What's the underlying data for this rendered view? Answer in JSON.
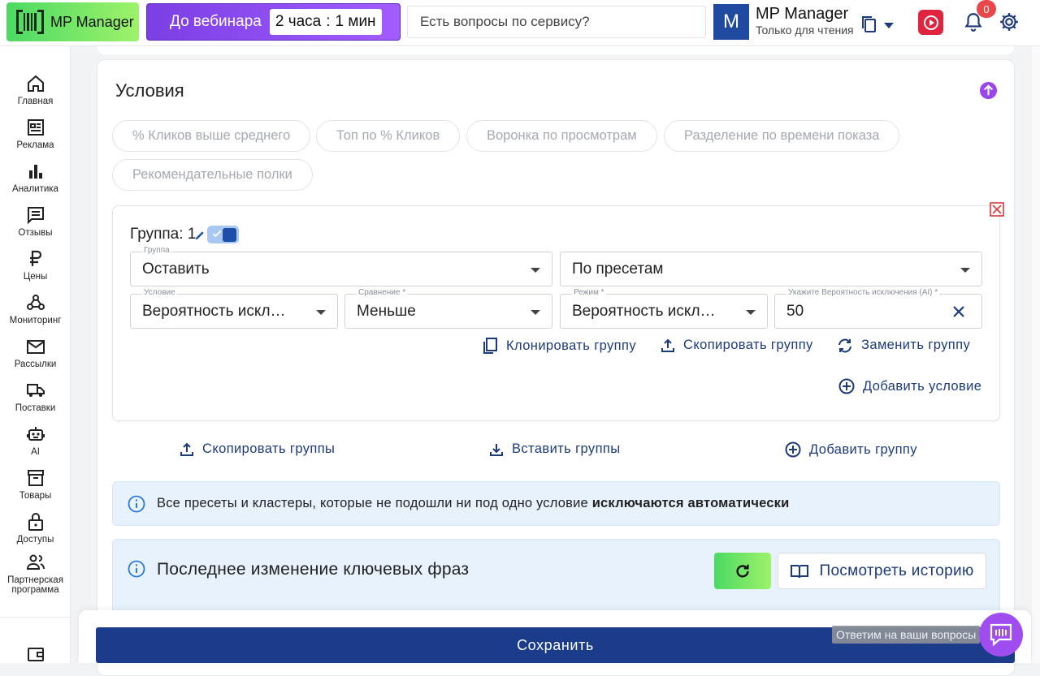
{
  "header": {
    "logo_text": "MP Manager",
    "webinar_label": "До вебинара",
    "timer_hours": "2 часа",
    "timer_sep": ":",
    "timer_minutes": "1 мин",
    "search_placeholder": "Есть вопросы по сервису?",
    "avatar_letter": "M",
    "user_name": "MP Manager",
    "user_role": "Только для чтения",
    "notifications_count": "0"
  },
  "sidebar": {
    "items": [
      {
        "label": "Главная",
        "icon": "home-icon"
      },
      {
        "label": "Реклама",
        "icon": "ads-icon"
      },
      {
        "label": "Аналитика",
        "icon": "analytics-icon"
      },
      {
        "label": "Отзывы",
        "icon": "reviews-icon"
      },
      {
        "label": "Цены",
        "icon": "ruble-icon"
      },
      {
        "label": "Мониторинг",
        "icon": "monitoring-icon"
      },
      {
        "label": "Рассылки",
        "icon": "mail-icon"
      },
      {
        "label": "Поставки",
        "icon": "truck-icon"
      },
      {
        "label": "AI",
        "icon": "robot-icon"
      },
      {
        "label": "Товары",
        "icon": "box-icon"
      },
      {
        "label": "Доступы",
        "icon": "lock-icon"
      },
      {
        "label": "Партнерская программа",
        "icon": "partners-icon"
      }
    ]
  },
  "conditions": {
    "title": "Условия",
    "presets": [
      "% Кликов выше среднего",
      "Топ по % Кликов",
      "Воронка по просмотрам",
      "Разделение по времени показа",
      "Рекомендательные полки"
    ],
    "group": {
      "title": "Группа: 1",
      "group_label": "Группа",
      "group_value": "Оставить",
      "mode_value": "По пресетам",
      "condition_label": "Условие",
      "condition_value": "Вероятность исключения (AI)",
      "compare_label": "Сравнение *",
      "compare_value": "Меньше",
      "regime_label": "Режим *",
      "regime_value": "Вероятность исключения (AI)",
      "probability_label": "Укажите Вероятность исключения (AI) *",
      "probability_value": "50",
      "clone_label": "Клонировать группу",
      "copy_label": "Скопировать группу",
      "replace_label": "Заменить группу",
      "add_condition_label": "Добавить условие"
    },
    "copy_groups_label": "Скопировать группы",
    "paste_groups_label": "Вставить группы",
    "add_group_label": "Добавить группу",
    "info_text": "Все пресеты и кластеры, которые не подошли ни под одно условие",
    "info_bold": "исключаются автоматически"
  },
  "history": {
    "title": "Последнее изменение ключевых фраз",
    "history_button": "Посмотреть историю"
  },
  "footer": {
    "save_label": "Сохранить",
    "chat_tip": "Ответим на ваши вопросы"
  },
  "colors": {
    "accent": "#1b3c8a",
    "brand_green": "#4cd964",
    "webinar_purple": "#7b3fe4",
    "info_bg": "#e7f2fc"
  }
}
